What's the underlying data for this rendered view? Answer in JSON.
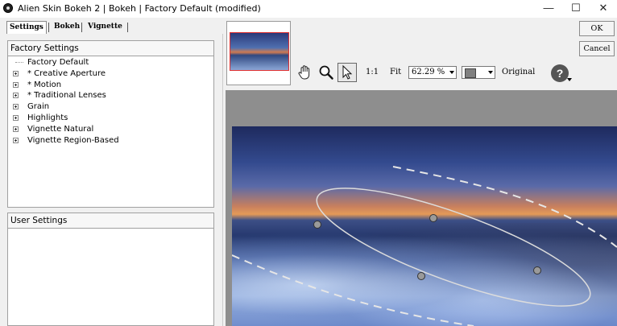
{
  "window": {
    "title": "Alien Skin Bokeh 2 | Bokeh | Factory Default (modified)",
    "minimize_glyph": "—",
    "maximize_glyph": "☐",
    "close_glyph": "✕"
  },
  "tabs": [
    {
      "label": "Settings",
      "active": true
    },
    {
      "label": "Bokeh",
      "active": false
    },
    {
      "label": "Vignette",
      "active": false
    }
  ],
  "factory_panel": {
    "header": "Factory Settings",
    "items": [
      {
        "label": "Factory Default",
        "expandable": false
      },
      {
        "label": "* Creative Aperture",
        "expandable": true
      },
      {
        "label": "* Motion",
        "expandable": true
      },
      {
        "label": "* Traditional Lenses",
        "expandable": true
      },
      {
        "label": "Grain",
        "expandable": true
      },
      {
        "label": "Highlights",
        "expandable": true
      },
      {
        "label": "Vignette Natural",
        "expandable": true
      },
      {
        "label": "Vignette Region-Based",
        "expandable": true
      }
    ]
  },
  "user_panel": {
    "header": "User Settings"
  },
  "toolbar": {
    "zoom_1to1": "1:1",
    "fit_label": "Fit",
    "zoom_value": "62.29 %",
    "original_label": "Original",
    "help_glyph": "?"
  },
  "buttons": {
    "ok": "OK",
    "cancel": "Cancel"
  },
  "colors": {
    "thumb_border": "#e03030",
    "preview_bg": "#8e8e8e"
  }
}
